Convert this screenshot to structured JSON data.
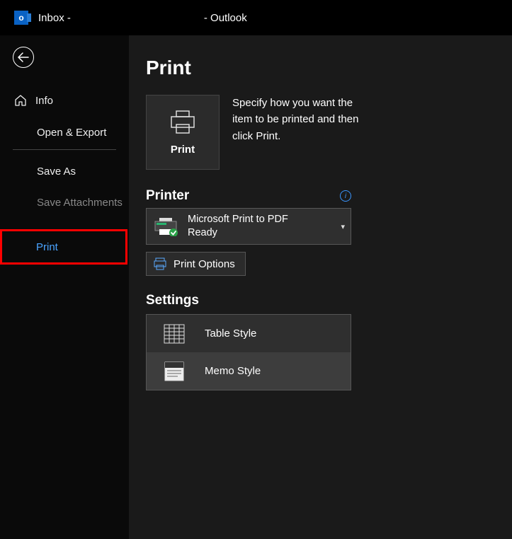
{
  "titlebar": {
    "prefix": "Inbox -",
    "suffix": "-  Outlook"
  },
  "sidebar": {
    "info": "Info",
    "open_export": "Open & Export",
    "save_as": "Save As",
    "save_attachments": "Save Attachments",
    "print": "Print"
  },
  "main": {
    "title": "Print",
    "print_button": "Print",
    "description": "Specify how you want the item to be printed and then click Print.",
    "printer_heading": "Printer",
    "printer_name": "Microsoft Print to PDF",
    "printer_status": "Ready",
    "print_options": "Print Options",
    "settings_heading": "Settings",
    "style_table": "Table Style",
    "style_memo": "Memo Style"
  }
}
